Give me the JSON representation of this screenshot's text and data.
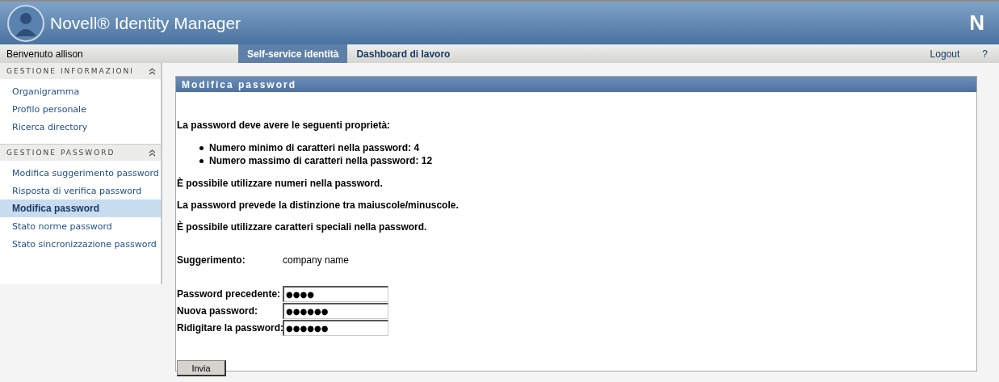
{
  "header": {
    "title": "Novell® Identity Manager",
    "logo_letter": "N"
  },
  "nav": {
    "welcome": "Benvenuto allison",
    "tabs": [
      {
        "label": "Self-service identità",
        "selected": true
      },
      {
        "label": "Dashboard di lavoro",
        "selected": false
      }
    ],
    "links": [
      "Logout",
      "?"
    ]
  },
  "sidebar": {
    "sections": [
      {
        "title": "GESTIONE INFORMAZIONI",
        "expanded": true,
        "items": [
          {
            "label": "Organigramma",
            "selected": false
          },
          {
            "label": "Profilo personale",
            "selected": false
          },
          {
            "label": "Ricerca directory",
            "selected": false
          }
        ]
      },
      {
        "title": "GESTIONE PASSWORD",
        "expanded": true,
        "items": [
          {
            "label": "Modifica suggerimento password",
            "selected": false
          },
          {
            "label": "Risposta di verifica password",
            "selected": false
          },
          {
            "label": "Modifica password",
            "selected": true
          },
          {
            "label": "Stato norme password",
            "selected": false
          },
          {
            "label": "Stato sincronizzazione password",
            "selected": false
          }
        ]
      }
    ]
  },
  "panel": {
    "title": "Modifica password",
    "intro": "La password deve avere le seguenti proprietà:",
    "rules": [
      "Numero minimo di caratteri nella password: 4",
      "Numero massimo di caratteri nella password: 12"
    ],
    "notes": [
      "È possibile utilizzare numeri nella password.",
      "La password prevede la distinzione tra maiuscole/minuscole.",
      "È possibile utilizzare caratteri speciali nella password."
    ],
    "hint": {
      "label": "Suggerimento:",
      "value": "company name"
    },
    "fields": [
      {
        "label": "Password precedente:",
        "value": "●●●●"
      },
      {
        "label": "Nuova password:",
        "value": "●●●●●●"
      },
      {
        "label": "Ridigitare la password:",
        "value": "●●●●●●"
      }
    ],
    "submit": "Invia"
  }
}
